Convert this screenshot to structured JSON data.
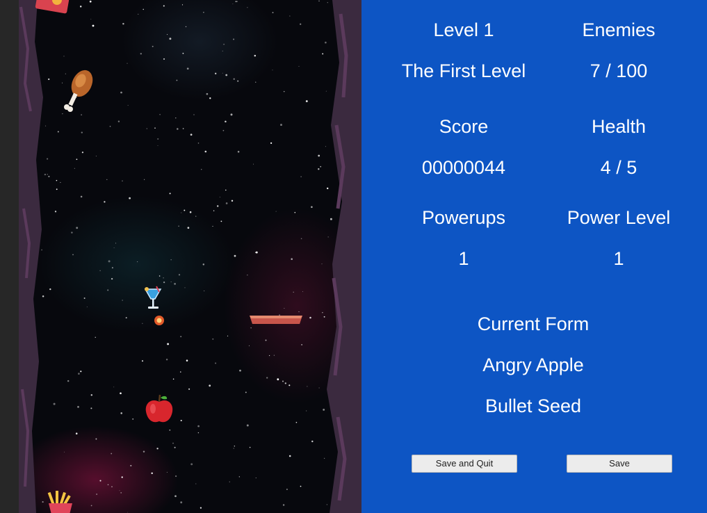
{
  "hud": {
    "level_label": "Level 1",
    "level_name": "The First Level",
    "enemies_label": "Enemies",
    "enemies_value": "7 / 100",
    "score_label": "Score",
    "score_value": "00000044",
    "health_label": "Health",
    "health_value": "4 / 5",
    "powerups_label": "Powerups",
    "powerups_value": "1",
    "power_level_label": "Power Level",
    "power_level_value": "1",
    "current_form_label": "Current Form",
    "current_form_value": "Angry Apple",
    "attack_name": "Bullet Seed"
  },
  "buttons": {
    "save_and_quit": "Save and Quit",
    "save": "Save"
  },
  "colors": {
    "panel": "#0d55c4",
    "space": "#07080d",
    "wall": "#3b2a3f",
    "wall_stripe": "#5b3a5c"
  },
  "sprites": [
    "pizza-box-icon",
    "chicken-drumstick-icon",
    "cocktail-glass-icon",
    "bullet-seed-icon",
    "pie-platform-icon",
    "apple-icon",
    "fries-icon"
  ]
}
